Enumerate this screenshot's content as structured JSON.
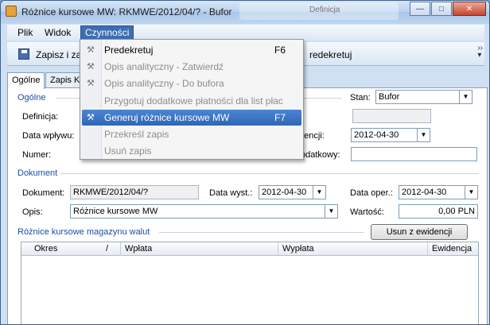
{
  "window": {
    "title": "Różnice kursowe MW: RKMWE/2012/04/? - Bufor",
    "background_window_title": "Definicja"
  },
  "menubar": {
    "items": [
      "Plik",
      "Widok",
      "Czynności"
    ]
  },
  "toolbar": {
    "save_label": "Zapisz i za",
    "predekretuj_label": "redekretuj"
  },
  "tabs": [
    "Ogólne",
    "Zapis K"
  ],
  "form": {
    "ogolne_section": "Ogólne",
    "definicja_label": "Definicja:",
    "data_wplywu_label": "Data wpływu:",
    "numer_label": "Numer:",
    "stan_label": "Stan:",
    "stan_value": "Bufor",
    "data_ewidencji_label": "dencji:",
    "data_ewidencji_value": "2012-04-30",
    "numer_dodatkowy_label": "odatkowy:",
    "dokument_section": "Dokument",
    "dokument_label": "Dokument:",
    "dokument_value": "RKMWE/2012/04/?",
    "data_wyst_label": "Data wyst.:",
    "data_wyst_value": "2012-04-30",
    "data_oper_label": "Data oper.:",
    "data_oper_value": "2012-04-30",
    "opis_label": "Opis:",
    "opis_value": "Różnice kursowe MW",
    "wartosc_label": "Wartość:",
    "wartosc_value": "0,00 PLN",
    "rozn_section": "Różnice kursowe magazynu walut",
    "usun_button": "Usun z ewidencji"
  },
  "grid": {
    "columns": [
      "Okres",
      "/",
      "Wpłata",
      "Wypłata",
      "Ewidencja"
    ]
  },
  "dropdown_menu": {
    "items": [
      {
        "label": "Predekretuj",
        "shortcut": "F6",
        "disabled": false,
        "highlighted": false,
        "icon": "wand-icon"
      },
      {
        "label": "Opis analityczny - Zatwierdź",
        "shortcut": "",
        "disabled": true,
        "highlighted": false,
        "icon": "wand-icon"
      },
      {
        "label": "Opis analityczny - Do bufora",
        "shortcut": "",
        "disabled": true,
        "highlighted": false,
        "icon": "wand-icon"
      },
      {
        "label": "Przygotuj dodatkowe płatności dla list płac",
        "shortcut": "",
        "disabled": true,
        "highlighted": false,
        "icon": ""
      },
      {
        "label": "Generuj różnice kursowe MW",
        "shortcut": "F7",
        "disabled": false,
        "highlighted": true,
        "icon": "wand-icon"
      },
      {
        "label": "Przekreśl zapis",
        "shortcut": "",
        "disabled": true,
        "highlighted": false,
        "icon": ""
      },
      {
        "label": "Usuń zapis",
        "shortcut": "",
        "disabled": true,
        "highlighted": false,
        "icon": ""
      }
    ]
  }
}
